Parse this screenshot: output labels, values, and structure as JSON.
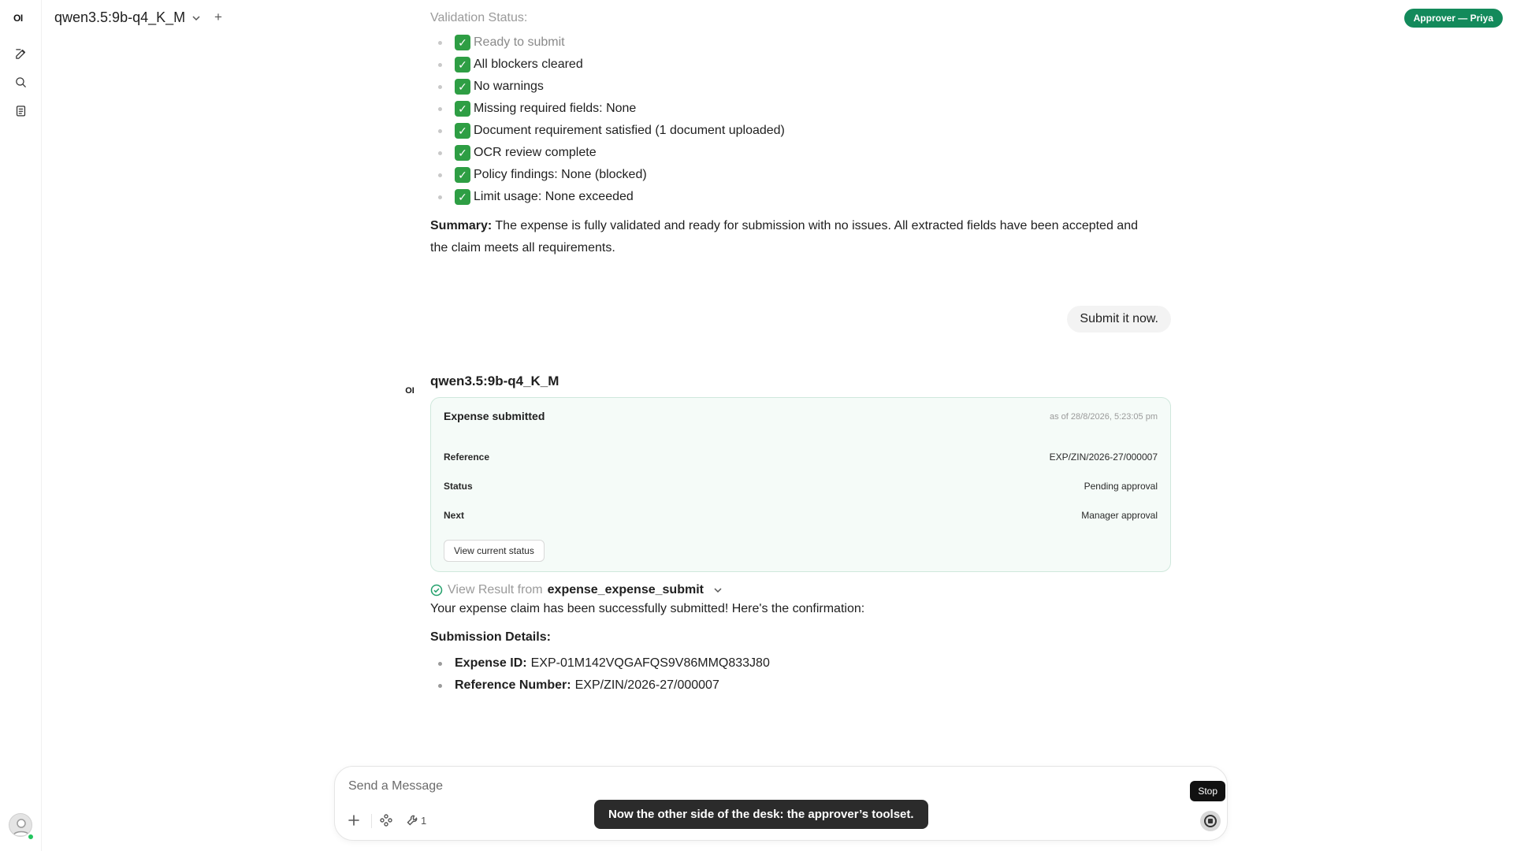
{
  "sidebar": {
    "logo": "OI",
    "icons": [
      "new-chat-icon",
      "search-icon",
      "notes-icon"
    ]
  },
  "header": {
    "model": "qwen3.5:9b-q4_K_M",
    "add_label": "+",
    "role_badge": "Approver — Priya"
  },
  "validation": {
    "heading": "Validation Status:",
    "items": [
      "Ready to submit",
      "All blockers cleared",
      "No warnings",
      "Missing required fields: None",
      "Document requirement satisfied (1 document uploaded)",
      "OCR review complete",
      "Policy findings: None (blocked)",
      "Limit usage: None exceeded"
    ],
    "check_glyph": "✓"
  },
  "summary": {
    "label": "Summary:",
    "text": " The expense is fully validated and ready for submission with no issues. All extracted fields have been accepted and the claim meets all requirements."
  },
  "user_message": "Submit it now.",
  "assistant": {
    "avatar": "OI",
    "name": "qwen3.5:9b-q4_K_M",
    "card": {
      "title": "Expense submitted",
      "timestamp": "as of 28/8/2026, 5:23:05 pm",
      "rows": [
        {
          "key": "Reference",
          "value": "EXP/ZIN/2026-27/000007"
        },
        {
          "key": "Status",
          "value": "Pending approval"
        },
        {
          "key": "Next",
          "value": "Manager approval"
        }
      ],
      "button": "View current status"
    },
    "tool_result": {
      "label": "View Result from ",
      "tool": "expense_expense_submit"
    },
    "response": "Your expense claim has been successfully submitted! Here's the confirmation:",
    "details_heading": "Submission Details:",
    "details": [
      {
        "label": "Expense ID:",
        "value": "EXP-01M142VQGAFQS9V86MMQ833J80"
      },
      {
        "label": "Reference Number:",
        "value": "EXP/ZIN/2026-27/000007"
      }
    ]
  },
  "composer": {
    "placeholder": "Send a Message",
    "tools_count": "1",
    "stop_tooltip": "Stop"
  },
  "toast": "Now the other side of the desk: the approver’s toolset."
}
